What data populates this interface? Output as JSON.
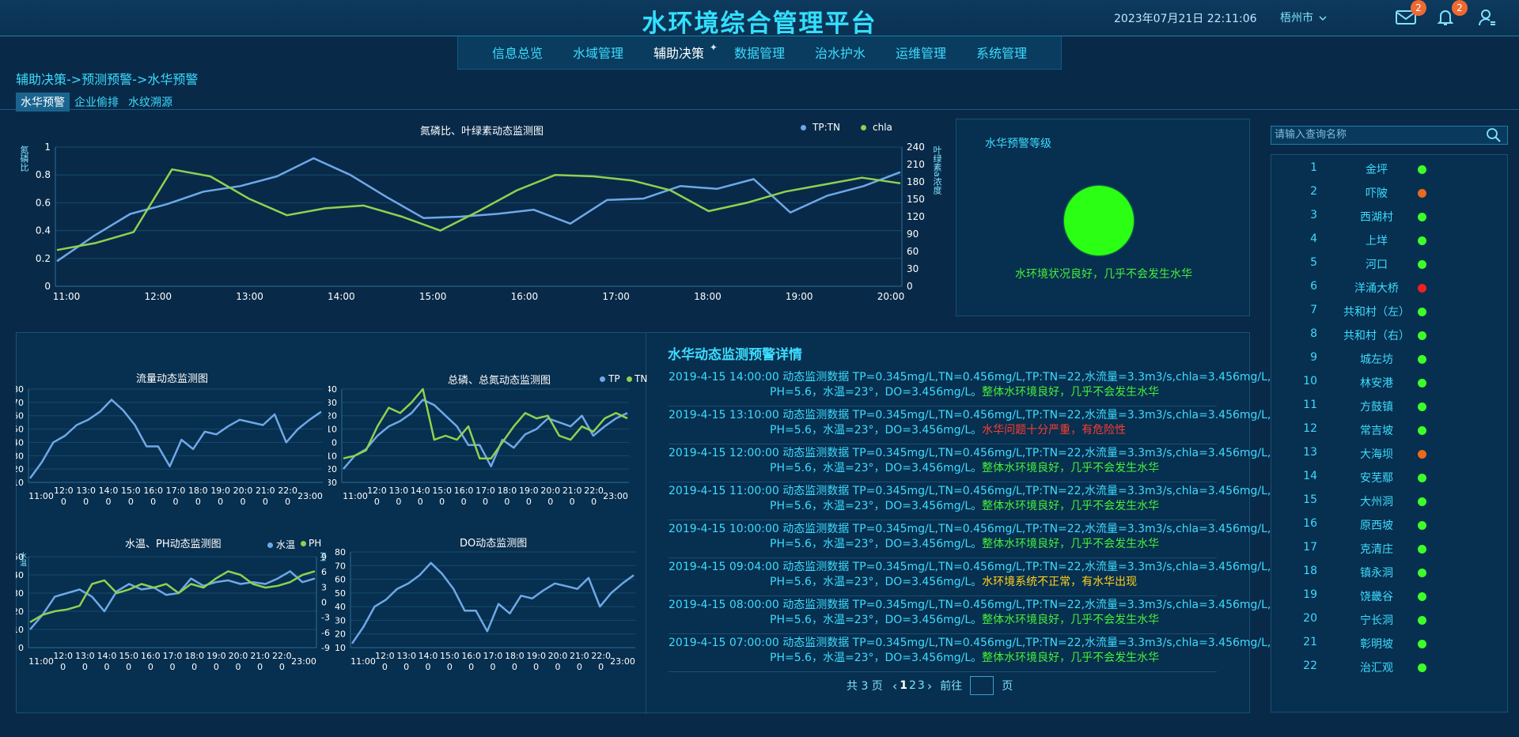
{
  "header": {
    "title": "水环境综合管理平台",
    "datetime": "2023年07月21日 22:11:06",
    "city": "梧州市",
    "mail_count": "2",
    "bell_count": "2"
  },
  "nav": {
    "items": [
      {
        "label": "信息总览"
      },
      {
        "label": "水域管理"
      },
      {
        "label": "辅助决策",
        "active": true
      },
      {
        "label": "数据管理"
      },
      {
        "label": "治水护水"
      },
      {
        "label": "运维管理"
      },
      {
        "label": "系统管理"
      }
    ]
  },
  "breadcrumb": "辅助决策->预测预警->水华预警",
  "tabs": [
    {
      "label": "水华预警",
      "active": true
    },
    {
      "label": "企业偷排"
    },
    {
      "label": "水纹溯源"
    }
  ],
  "charts": {
    "main": {
      "title": "氮磷比、叶绿素动态监测图",
      "ylabel_left": "氮磷比",
      "ylabel_right": "叶绿素a浓度",
      "legend": [
        "TP:TN",
        "chla"
      ]
    },
    "flow": {
      "title": "流量动态监测图"
    },
    "tptn": {
      "title": "总磷、总氮动态监测图",
      "legend": [
        "TP",
        "TN"
      ]
    },
    "temp": {
      "title": "水温、PH动态监测图",
      "legend": [
        "水温",
        "PH"
      ],
      "ylabel_left": "水温",
      "ylabel_right": "PH"
    },
    "do": {
      "title": "DO动态监测图"
    }
  },
  "colors": {
    "blue_series": "#6fa8e8",
    "green_series": "#8fd14f",
    "accent": "#3ddcff"
  },
  "chart_data": [
    {
      "type": "line",
      "title": "氮磷比、叶绿素动态监测图",
      "x": [
        "11:00",
        "11:30",
        "12:00",
        "12:30",
        "13:00",
        "13:30",
        "14:00",
        "14:30",
        "15:00",
        "15:30",
        "16:00",
        "16:30",
        "17:00",
        "17:30",
        "18:00",
        "18:30",
        "19:00",
        "19:30",
        "20:00"
      ],
      "ylim_left": [
        0,
        1
      ],
      "ylim_right": [
        0,
        240
      ],
      "yticks_left": [
        0,
        0.2,
        0.4,
        0.6,
        0.8,
        1
      ],
      "yticks_right": [
        0,
        30,
        60,
        90,
        120,
        150,
        180,
        210,
        240
      ],
      "xticks": [
        "11:00",
        "12:00",
        "13:00",
        "14:00",
        "15:00",
        "16:00",
        "17:00",
        "18:00",
        "19:00",
        "20:00"
      ],
      "series": [
        {
          "name": "TP:TN",
          "axis": "left",
          "values": [
            0.18,
            0.36,
            0.52,
            0.59,
            0.68,
            0.72,
            0.79,
            0.92,
            0.8,
            0.64,
            0.49,
            0.5,
            0.52,
            0.55,
            0.45,
            0.62,
            0.63,
            0.72,
            0.7,
            0.77,
            0.53,
            0.65,
            0.72,
            0.82
          ]
        },
        {
          "name": "chla",
          "axis": "left",
          "values": [
            0.26,
            0.31,
            0.39,
            0.84,
            0.79,
            0.63,
            0.51,
            0.56,
            0.58,
            0.5,
            0.4,
            0.54,
            0.69,
            0.8,
            0.79,
            0.76,
            0.69,
            0.54,
            0.6,
            0.68,
            0.73,
            0.78,
            0.74
          ]
        }
      ]
    },
    {
      "type": "line",
      "title": "流量动态监测图",
      "x": [
        "11:00",
        "12:00",
        "13:00",
        "14:00",
        "15:00",
        "16:00",
        "17:00",
        "18:00",
        "19:00",
        "20:00",
        "21:00",
        "22:00",
        "23:00"
      ],
      "xticks": [
        "11:00",
        "12:00",
        "13:00",
        "14:00",
        "15:00",
        "16:00",
        "17:00",
        "18:00",
        "19:00",
        "20:00",
        "21:00",
        "22:00",
        "23:00"
      ],
      "ylim": [
        10,
        80
      ],
      "yticks": [
        10,
        20,
        30,
        40,
        50,
        60,
        70,
        80
      ],
      "series": [
        {
          "name": "流量",
          "values": [
            13,
            25,
            40,
            45,
            53,
            57,
            63,
            72,
            64,
            53,
            37,
            37,
            22,
            42,
            35,
            48,
            46,
            52,
            57,
            55,
            53,
            61,
            40,
            50,
            57,
            63
          ]
        }
      ]
    },
    {
      "type": "line",
      "title": "总磷、总氮动态监测图",
      "xticks": [
        "11:00",
        "12:00",
        "13:00",
        "14:00",
        "15:00",
        "16:00",
        "17:00",
        "18:00",
        "19:00",
        "20:00",
        "21:00",
        "22:00",
        "23:00"
      ],
      "ylim": [
        -30,
        40
      ],
      "yticks": [
        -30,
        -20,
        -10,
        0,
        10,
        20,
        30,
        40
      ],
      "series": [
        {
          "name": "TP",
          "values": [
            -20,
            -10,
            -5,
            5,
            12,
            16,
            22,
            32,
            28,
            20,
            12,
            -2,
            -2,
            -18,
            2,
            -4,
            6,
            10,
            18,
            15,
            12,
            20,
            5,
            12,
            18,
            22
          ]
        },
        {
          "name": "TN",
          "values": [
            -12,
            -10,
            -6,
            12,
            26,
            22,
            30,
            40,
            2,
            5,
            2,
            12,
            -12,
            -12,
            0,
            12,
            22,
            18,
            20,
            5,
            2,
            12,
            8,
            18,
            22,
            18
          ]
        }
      ]
    },
    {
      "type": "line",
      "title": "水温、PH动态监测图",
      "xticks": [
        "11:00",
        "12:00",
        "13:00",
        "14:00",
        "15:00",
        "16:00",
        "17:00",
        "18:00",
        "19:00",
        "20:00",
        "21:00",
        "22:00",
        "23:00"
      ],
      "ylim_left": [
        0,
        50
      ],
      "ylim_right": [
        -9,
        9
      ],
      "yticks_left": [
        0,
        10,
        20,
        30,
        40,
        50
      ],
      "yticks_right": [
        -9,
        -6,
        -3,
        0,
        3,
        6,
        9
      ],
      "series": [
        {
          "name": "水温",
          "axis": "left",
          "values": [
            10,
            18,
            28,
            30,
            32,
            28,
            20,
            31,
            35,
            32,
            33,
            29,
            30,
            38,
            34,
            36,
            37,
            35,
            36,
            35,
            38,
            42,
            36,
            38
          ]
        },
        {
          "name": "PH",
          "axis": "left",
          "values": [
            14,
            18,
            20,
            21,
            23,
            35,
            37,
            30,
            32,
            35,
            33,
            35,
            30,
            35,
            33,
            38,
            42,
            40,
            35,
            33,
            34,
            36,
            40,
            42
          ]
        }
      ]
    },
    {
      "type": "line",
      "title": "DO动态监测图",
      "xticks": [
        "11:00",
        "12:00",
        "13:00",
        "14:00",
        "15:00",
        "16:00",
        "17:00",
        "18:00",
        "19:00",
        "20:00",
        "21:00",
        "22:00",
        "23:00"
      ],
      "ylim": [
        10,
        80
      ],
      "yticks": [
        10,
        20,
        30,
        40,
        50,
        60,
        70,
        80
      ],
      "series": [
        {
          "name": "DO",
          "values": [
            13,
            25,
            40,
            45,
            53,
            57,
            63,
            72,
            64,
            53,
            37,
            37,
            22,
            42,
            35,
            48,
            46,
            52,
            57,
            55,
            53,
            61,
            40,
            50,
            57,
            63
          ]
        }
      ]
    }
  ],
  "bloom": {
    "title": "水华预警等级",
    "status": "水环境状况良好，几乎不会发生水华",
    "color": "#2aff14"
  },
  "stations": {
    "search_placeholder": "请输入查询名称",
    "items": [
      {
        "no": "1",
        "name": "金坪",
        "color": "#3cff2a"
      },
      {
        "no": "2",
        "name": "吓陂",
        "color": "#e86a1c"
      },
      {
        "no": "3",
        "name": "西湖村",
        "color": "#3cff2a"
      },
      {
        "no": "4",
        "name": "上垟",
        "color": "#3cff2a"
      },
      {
        "no": "5",
        "name": "河口",
        "color": "#3cff2a"
      },
      {
        "no": "6",
        "name": "洋涌大桥",
        "color": "#f02020"
      },
      {
        "no": "7",
        "name": "共和村（左）",
        "color": "#3cff2a"
      },
      {
        "no": "8",
        "name": "共和村（右）",
        "color": "#3cff2a"
      },
      {
        "no": "9",
        "name": "城左坊",
        "color": "#3cff2a"
      },
      {
        "no": "10",
        "name": "林安港",
        "color": "#3cff2a"
      },
      {
        "no": "11",
        "name": "方鼓镇",
        "color": "#3cff2a"
      },
      {
        "no": "12",
        "name": "常吉坡",
        "color": "#3cff2a"
      },
      {
        "no": "13",
        "name": "大海坝",
        "color": "#e86a1c"
      },
      {
        "no": "14",
        "name": "安芜鄢",
        "color": "#3cff2a"
      },
      {
        "no": "15",
        "name": "大州洞",
        "color": "#3cff2a"
      },
      {
        "no": "16",
        "name": "原西坡",
        "color": "#3cff2a"
      },
      {
        "no": "17",
        "name": "克清庄",
        "color": "#3cff2a"
      },
      {
        "no": "18",
        "name": "镇永洞",
        "color": "#3cff2a"
      },
      {
        "no": "19",
        "name": "饶畿谷",
        "color": "#3cff2a"
      },
      {
        "no": "20",
        "name": "宁长洞",
        "color": "#3cff2a"
      },
      {
        "no": "21",
        "name": "彰明坡",
        "color": "#3cff2a"
      },
      {
        "no": "22",
        "name": "治汇观",
        "color": "#3cff2a"
      }
    ]
  },
  "details": {
    "title": "水华动态监测预警详情",
    "items": [
      {
        "time": "2019-4-15 14:00:00",
        "line1": "动态监测数据 TP=0.345mg/L,TN=0.456mg/L,TP:TN=22,水流量=3.3m3/s,chla=3.456mg/L,",
        "line2": "PH=5.6，水温=23°，DO=3.456mg/L。",
        "status": "整体水环境良好，几乎不会发生水华",
        "level": "good"
      },
      {
        "time": "2019-4-15 13:10:00",
        "line1": "动态监测数据 TP=0.345mg/L,TN=0.456mg/L,TP:TN=22,水流量=3.3m3/s,chla=3.456mg/L,",
        "line2": "PH=5.6，水温=23°，DO=3.456mg/L。",
        "status": "水华问题十分严重，有危险性",
        "level": "bad"
      },
      {
        "time": "2019-4-15 12:00:00",
        "line1": "动态监测数据 TP=0.345mg/L,TN=0.456mg/L,TP:TN=22,水流量=3.3m3/s,chla=3.456mg/L,",
        "line2": "PH=5.6，水温=23°，DO=3.456mg/L。",
        "status": "整体水环境良好，几乎不会发生水华",
        "level": "good"
      },
      {
        "time": "2019-4-15 11:00:00",
        "line1": "动态监测数据 TP=0.345mg/L,TN=0.456mg/L,TP:TN=22,水流量=3.3m3/s,chla=3.456mg/L,",
        "line2": "PH=5.6，水温=23°，DO=3.456mg/L。",
        "status": "整体水环境良好，几乎不会发生水华",
        "level": "good"
      },
      {
        "time": "2019-4-15 10:00:00",
        "line1": "动态监测数据 TP=0.345mg/L,TN=0.456mg/L,TP:TN=22,水流量=3.3m3/s,chla=3.456mg/L,",
        "line2": "PH=5.6，水温=23°，DO=3.456mg/L。",
        "status": "整体水环境良好，几乎不会发生水华",
        "level": "good"
      },
      {
        "time": "2019-4-15 09:04:00",
        "line1": "动态监测数据 TP=0.345mg/L,TN=0.456mg/L,TP:TN=22,水流量=3.3m3/s,chla=3.456mg/L,",
        "line2": "PH=5.6，水温=23°，DO=3.456mg/L。",
        "status": "水环境系统不正常，有水华出现",
        "level": "warn"
      },
      {
        "time": "2019-4-15 08:00:00",
        "line1": "动态监测数据 TP=0.345mg/L,TN=0.456mg/L,TP:TN=22,水流量=3.3m3/s,chla=3.456mg/L,",
        "line2": "PH=5.6，水温=23°，DO=3.456mg/L。",
        "status": "整体水环境良好，几乎不会发生水华",
        "level": "good"
      },
      {
        "time": "2019-4-15 07:00:00",
        "line1": "动态监测数据 TP=0.345mg/L,TN=0.456mg/L,TP:TN=22,水流量=3.3m3/s,chla=3.456mg/L,",
        "line2": "PH=5.6，水温=23°，DO=3.456mg/L。",
        "status": "整体水环境良好，几乎不会发生水华",
        "level": "good"
      }
    ]
  },
  "pagination": {
    "total_label": "共 3 页",
    "pages": [
      "1",
      "2",
      "3"
    ],
    "current": "1",
    "goto_label": "前往",
    "page_suffix": "页"
  }
}
